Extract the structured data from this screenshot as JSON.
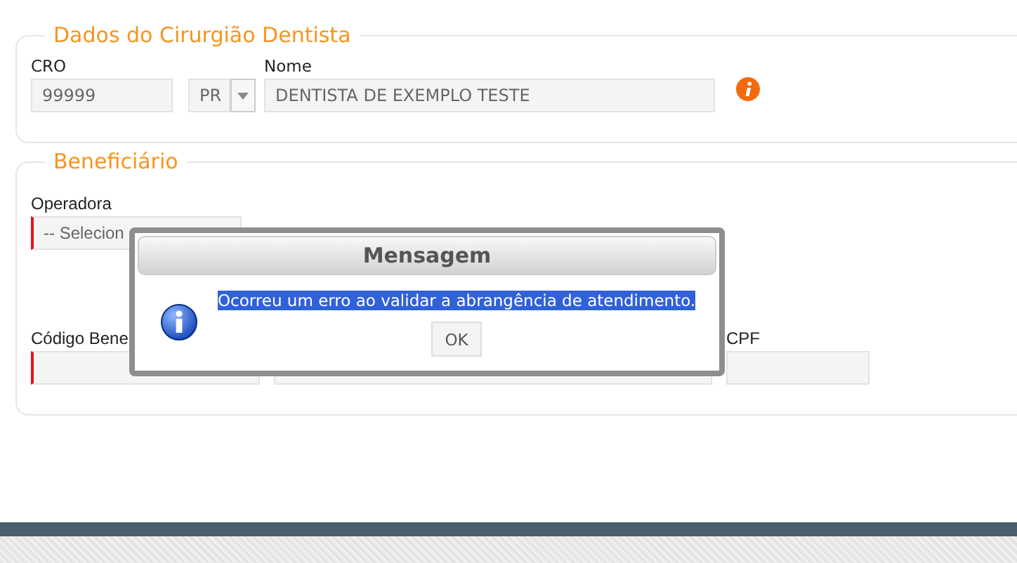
{
  "sections": [
    {
      "legend": "Dados do Cirurgião Dentista",
      "kind": "dentist",
      "fields": [
        {
          "kind": "text",
          "label": "CRO",
          "value": "99999",
          "required": false
        },
        {
          "kind": "select",
          "value": "PR",
          "required": false
        },
        {
          "kind": "text",
          "label": "Nome",
          "value": "DENTISTA DE EXEMPLO TESTE",
          "required": false
        },
        {
          "kind": "info"
        }
      ]
    },
    {
      "legend": "Beneficiário",
      "kind": "beneficiary",
      "rows": [
        [
          {
            "kind": "text",
            "label": "Operadora",
            "value": "-- Selecion",
            "required": true
          }
        ],
        [
          {
            "kind": "text",
            "label": "Código Bene",
            "required": true
          },
          {
            "kind": "text",
            "required": false
          },
          {
            "kind": "text",
            "label": "CPF",
            "required": false
          }
        ]
      ]
    }
  ],
  "dialog": {
    "title": "Mensagem",
    "message": "Ocorreu um erro ao validar a abrangência de atendimento.",
    "message_selected": true,
    "button": "OK"
  }
}
